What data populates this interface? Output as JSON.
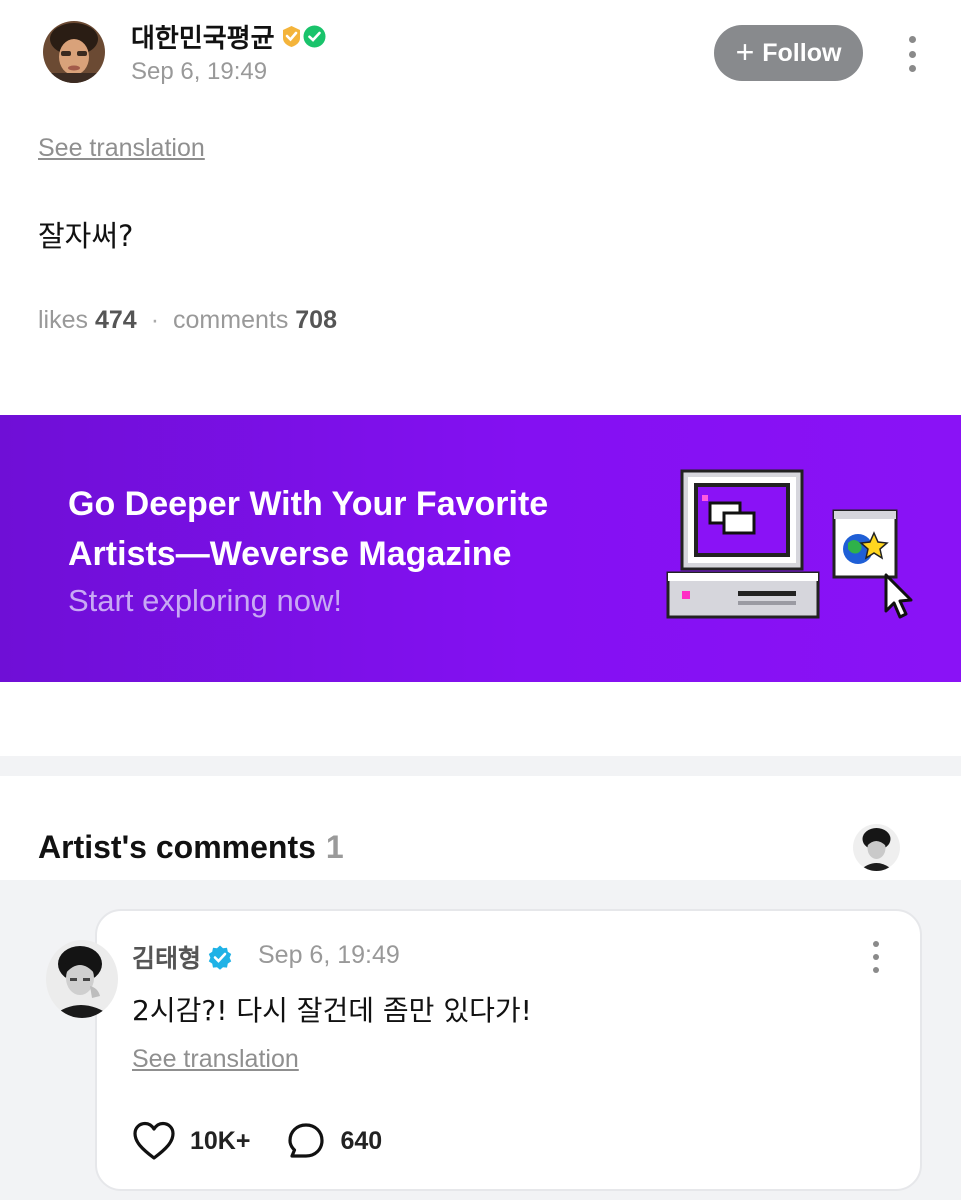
{
  "post": {
    "author": "대한민국평균",
    "badges": [
      "gold-heart-check-badge",
      "green-check-badge"
    ],
    "date": "Sep 6, 19:49",
    "follow_label": "Follow",
    "see_translation": "See translation",
    "body": "잘자써?",
    "likes_label": "likes",
    "likes_count": "474",
    "comments_label": "comments",
    "comments_count": "708"
  },
  "banner": {
    "title": "Go Deeper With Your Favorite Artists—Weverse Magazine",
    "subtitle": "Start exploring now!",
    "colors": {
      "bg_start": "#6f0fd6",
      "bg_end": "#8a12f6"
    }
  },
  "artist_comments": {
    "heading": "Artist's comments",
    "count": "1",
    "comment": {
      "author": "김태형",
      "verified_icon": "verified-badge-icon",
      "date": "Sep 6, 19:49",
      "text": "2시감?! 다시 잘건데 좀만 있다가!",
      "see_translation": "See translation",
      "like_count": "10K+",
      "reply_count": "640"
    }
  },
  "colors": {
    "follow_button": "#888a8d",
    "muted_text": "#999999",
    "section_bg": "#f2f3f5",
    "verified_blue": "#1fb2e6"
  }
}
